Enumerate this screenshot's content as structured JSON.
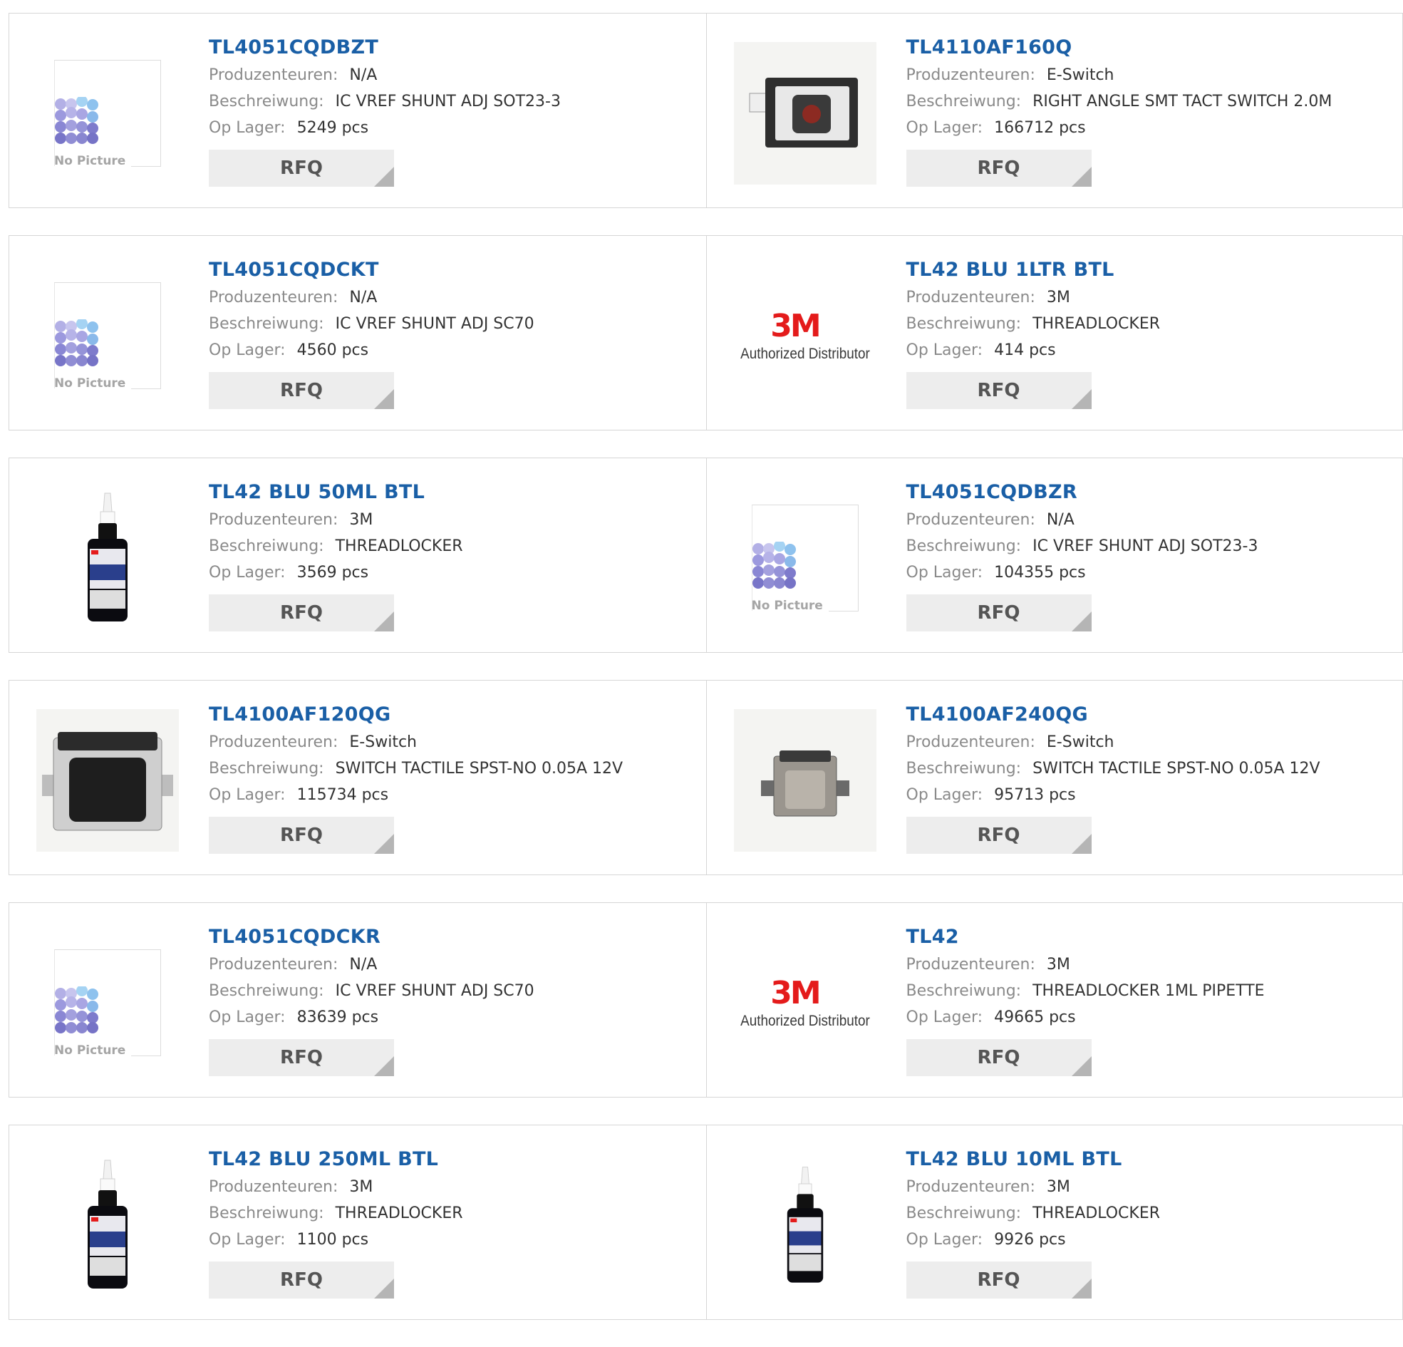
{
  "labels": {
    "manufacturer": "Produzenteuren:",
    "description": "Beschreiwung:",
    "stock": "Op Lager:",
    "rfq": "RFQ",
    "no_picture": "No Picture",
    "logo_3m": "3M",
    "authorized_distributor": "Authorized Distributor"
  },
  "products": [
    {
      "pn": "TL4051CQDBZT",
      "manufacturer": "N/A",
      "description": "IC VREF SHUNT ADJ SOT23-3",
      "stock": "5249 pcs",
      "image": "no-picture"
    },
    {
      "pn": "TL4110AF160Q",
      "manufacturer": "E-Switch",
      "description": "RIGHT ANGLE SMT TACT SWITCH 2.0M",
      "stock": "166712 pcs",
      "image": "tact-switch-right-angle"
    },
    {
      "pn": "TL4051CQDCKT",
      "manufacturer": "N/A",
      "description": "IC VREF SHUNT ADJ SC70",
      "stock": "4560 pcs",
      "image": "no-picture"
    },
    {
      "pn": "TL42 BLU 1LTR BTL",
      "manufacturer": "3M",
      "description": "THREADLOCKER",
      "stock": "414 pcs",
      "image": "3m-logo"
    },
    {
      "pn": "TL42 BLU 50ML BTL",
      "manufacturer": "3M",
      "description": "THREADLOCKER",
      "stock": "3569 pcs",
      "image": "bottle"
    },
    {
      "pn": "TL4051CQDBZR",
      "manufacturer": "N/A",
      "description": "IC VREF SHUNT ADJ SOT23-3",
      "stock": "104355 pcs",
      "image": "no-picture"
    },
    {
      "pn": "TL4100AF120QG",
      "manufacturer": "E-Switch",
      "description": "SWITCH TACTILE SPST-NO 0.05A 12V",
      "stock": "115734 pcs",
      "image": "tactile-switch-large"
    },
    {
      "pn": "TL4100AF240QG",
      "manufacturer": "E-Switch",
      "description": "SWITCH TACTILE SPST-NO 0.05A 12V",
      "stock": "95713 pcs",
      "image": "tactile-switch-small"
    },
    {
      "pn": "TL4051CQDCKR",
      "manufacturer": "N/A",
      "description": "IC VREF SHUNT ADJ SC70",
      "stock": "83639 pcs",
      "image": "no-picture"
    },
    {
      "pn": "TL42",
      "manufacturer": "3M",
      "description": "THREADLOCKER 1ML PIPETTE",
      "stock": "49665 pcs",
      "image": "3m-logo"
    },
    {
      "pn": "TL42 BLU 250ML BTL",
      "manufacturer": "3M",
      "description": "THREADLOCKER",
      "stock": "1100 pcs",
      "image": "bottle"
    },
    {
      "pn": "TL42 BLU 10ML BTL",
      "manufacturer": "3M",
      "description": "THREADLOCKER",
      "stock": "9926 pcs",
      "image": "bottle-small"
    }
  ],
  "colors": {
    "link": "#1a5fa6",
    "label": "#8a8a8a",
    "value": "#333333",
    "border": "#d6d6d6",
    "button_bg": "#ededed",
    "brand_3m": "#e41b1b"
  }
}
